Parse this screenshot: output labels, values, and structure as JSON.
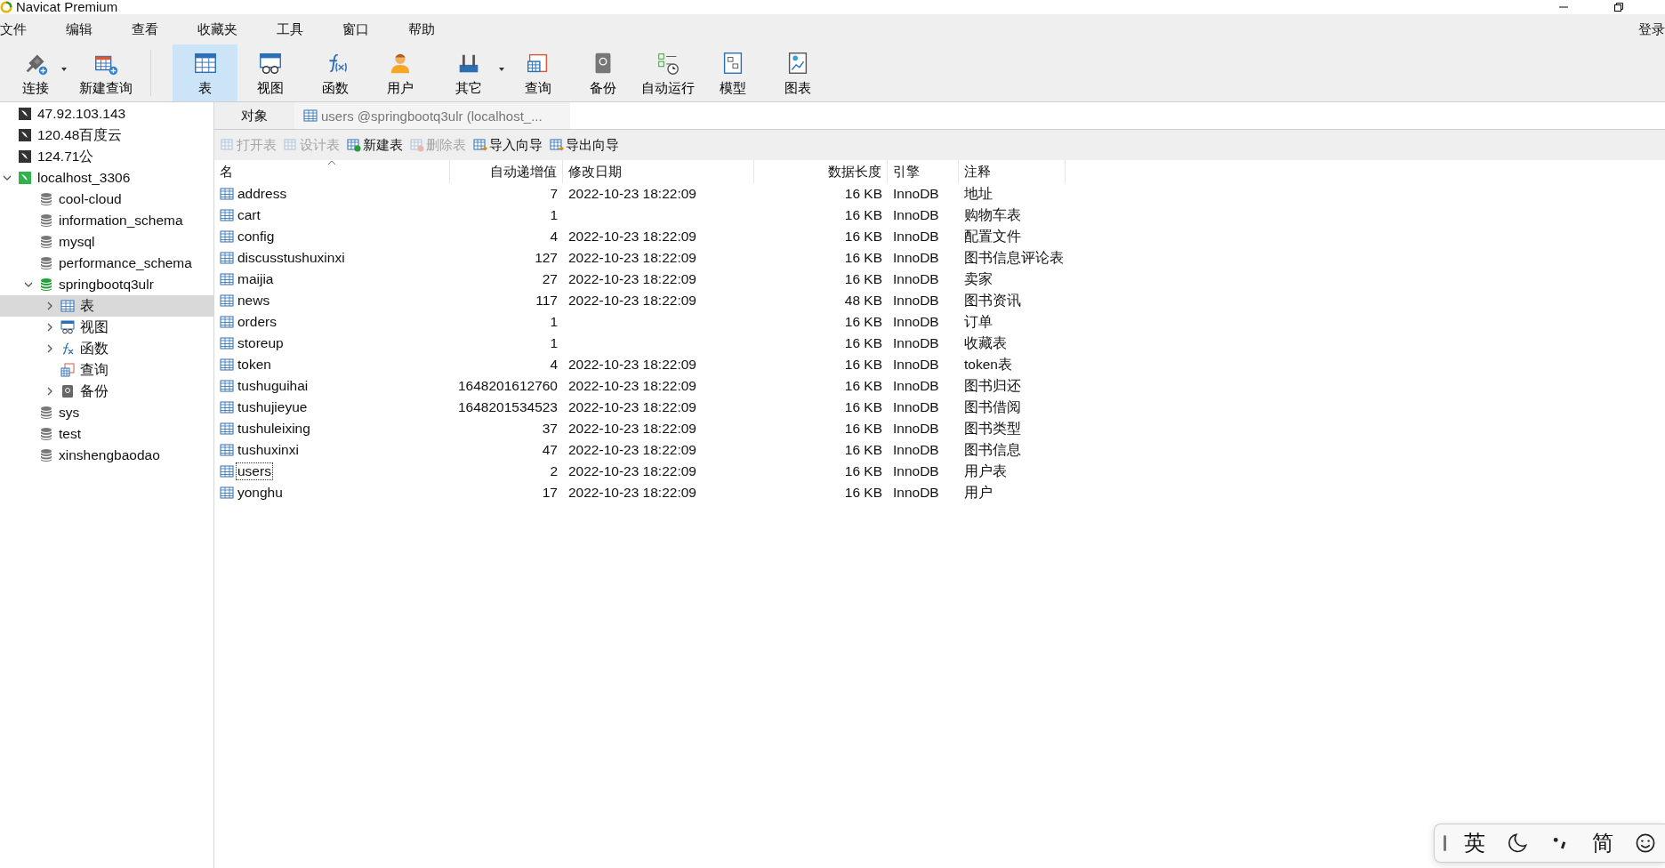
{
  "window": {
    "title": "Navicat Premium"
  },
  "menu": [
    "文件",
    "编辑",
    "查看",
    "收藏夹",
    "工具",
    "窗口",
    "帮助"
  ],
  "login": "登录",
  "toolbar": [
    {
      "label": "连接",
      "kind": "connect",
      "selected": false,
      "has_menu": true
    },
    {
      "label": "新建查询",
      "kind": "newquery",
      "selected": false,
      "has_menu": false
    },
    {
      "label": "表",
      "kind": "table",
      "selected": true,
      "has_menu": false
    },
    {
      "label": "视图",
      "kind": "view",
      "selected": false,
      "has_menu": false
    },
    {
      "label": "函数",
      "kind": "function",
      "selected": false,
      "has_menu": false
    },
    {
      "label": "用户",
      "kind": "user",
      "selected": false,
      "has_menu": false
    },
    {
      "label": "其它",
      "kind": "tools",
      "selected": false,
      "has_menu": true
    },
    {
      "label": "查询",
      "kind": "query",
      "selected": false,
      "has_menu": false
    },
    {
      "label": "备份",
      "kind": "backup",
      "selected": false,
      "has_menu": false
    },
    {
      "label": "自动运行",
      "kind": "schedule",
      "selected": false,
      "has_menu": false
    },
    {
      "label": "模型",
      "kind": "model",
      "selected": false,
      "has_menu": false
    },
    {
      "label": "图表",
      "kind": "chart",
      "selected": false,
      "has_menu": false
    }
  ],
  "sidebar": {
    "items": [
      {
        "label": "47.92.103.143",
        "kind": "connection",
        "active": false
      },
      {
        "label": "120.48百度云",
        "kind": "connection",
        "active": false
      },
      {
        "label": "124.71公",
        "kind": "connection",
        "active": false
      },
      {
        "label": "localhost_3306",
        "kind": "connection",
        "active": true,
        "expanded": true,
        "children": [
          {
            "label": "cool-cloud",
            "kind": "database",
            "active": false
          },
          {
            "label": "information_schema",
            "kind": "database",
            "active": false
          },
          {
            "label": "mysql",
            "kind": "database",
            "active": false
          },
          {
            "label": "performance_schema",
            "kind": "database",
            "active": false
          },
          {
            "label": "springbootq3ulr",
            "kind": "database",
            "active": true,
            "expanded": true,
            "children": [
              {
                "label": "表",
                "kind": "table",
                "selected": true,
                "expanded": false
              },
              {
                "label": "视图",
                "kind": "view",
                "selected": false,
                "expanded": false
              },
              {
                "label": "函数",
                "kind": "function",
                "selected": false,
                "expanded": false
              },
              {
                "label": "查询",
                "kind": "query",
                "selected": false
              },
              {
                "label": "备份",
                "kind": "backup",
                "selected": false,
                "expanded": false
              }
            ]
          },
          {
            "label": "sys",
            "kind": "database",
            "active": false
          },
          {
            "label": "test",
            "kind": "database",
            "active": false
          },
          {
            "label": "xinshengbaodao",
            "kind": "database",
            "active": false
          }
        ]
      }
    ]
  },
  "tabs": [
    {
      "label": "对象",
      "kind": "objects",
      "selected": true
    },
    {
      "label": "users @springbootq3ulr (localhost_...",
      "kind": "table",
      "selected": false
    }
  ],
  "actions": [
    {
      "label": "打开表",
      "kind": "open",
      "disabled": true
    },
    {
      "label": "设计表",
      "kind": "design",
      "disabled": true
    },
    {
      "label": "新建表",
      "kind": "new",
      "disabled": false
    },
    {
      "label": "删除表",
      "kind": "delete",
      "disabled": true
    },
    {
      "label": "导入向导",
      "kind": "import",
      "disabled": false
    },
    {
      "label": "导出向导",
      "kind": "export",
      "disabled": false
    }
  ],
  "table": {
    "columns": [
      {
        "label": "名",
        "sorted": true
      },
      {
        "label": "自动递增值",
        "sorted": false
      },
      {
        "label": "修改日期",
        "sorted": false
      },
      {
        "label": "数据长度",
        "sorted": false
      },
      {
        "label": "引擎",
        "sorted": false
      },
      {
        "label": "注释",
        "sorted": false
      }
    ],
    "rows": [
      {
        "name": "address",
        "auto_increment": "7",
        "modified": "2022-10-23 18:22:09",
        "data_length": "16 KB",
        "engine": "InnoDB",
        "comment": "地址",
        "focused": false
      },
      {
        "name": "cart",
        "auto_increment": "1",
        "data_length": "16 KB",
        "engine": "InnoDB",
        "comment": "购物车表",
        "focused": false
      },
      {
        "name": "config",
        "auto_increment": "4",
        "modified": "2022-10-23 18:22:09",
        "data_length": "16 KB",
        "engine": "InnoDB",
        "comment": "配置文件",
        "focused": false
      },
      {
        "name": "discusstushuxinxi",
        "auto_increment": "127",
        "modified": "2022-10-23 18:22:09",
        "data_length": "16 KB",
        "engine": "InnoDB",
        "comment": "图书信息评论表",
        "focused": false
      },
      {
        "name": "maijia",
        "auto_increment": "27",
        "modified": "2022-10-23 18:22:09",
        "data_length": "16 KB",
        "engine": "InnoDB",
        "comment": "卖家",
        "focused": false
      },
      {
        "name": "news",
        "auto_increment": "117",
        "modified": "2022-10-23 18:22:09",
        "data_length": "48 KB",
        "engine": "InnoDB",
        "comment": "图书资讯",
        "focused": false
      },
      {
        "name": "orders",
        "auto_increment": "1",
        "data_length": "16 KB",
        "engine": "InnoDB",
        "comment": "订单",
        "focused": false
      },
      {
        "name": "storeup",
        "auto_increment": "1",
        "data_length": "16 KB",
        "engine": "InnoDB",
        "comment": "收藏表",
        "focused": false
      },
      {
        "name": "token",
        "auto_increment": "4",
        "modified": "2022-10-23 18:22:09",
        "data_length": "16 KB",
        "engine": "InnoDB",
        "comment": "token表",
        "focused": false
      },
      {
        "name": "tushuguihai",
        "auto_increment": "1648201612760",
        "modified": "2022-10-23 18:22:09",
        "data_length": "16 KB",
        "engine": "InnoDB",
        "comment": "图书归还",
        "focused": false
      },
      {
        "name": "tushujieyue",
        "auto_increment": "1648201534523",
        "modified": "2022-10-23 18:22:09",
        "data_length": "16 KB",
        "engine": "InnoDB",
        "comment": "图书借阅",
        "focused": false
      },
      {
        "name": "tushuleixing",
        "auto_increment": "37",
        "modified": "2022-10-23 18:22:09",
        "data_length": "16 KB",
        "engine": "InnoDB",
        "comment": "图书类型",
        "focused": false
      },
      {
        "name": "tushuxinxi",
        "auto_increment": "47",
        "modified": "2022-10-23 18:22:09",
        "data_length": "16 KB",
        "engine": "InnoDB",
        "comment": "图书信息",
        "focused": false
      },
      {
        "name": "users",
        "auto_increment": "2",
        "modified": "2022-10-23 18:22:09",
        "data_length": "16 KB",
        "engine": "InnoDB",
        "comment": "用户表",
        "focused": true
      },
      {
        "name": "yonghu",
        "auto_increment": "17",
        "modified": "2022-10-23 18:22:09",
        "data_length": "16 KB",
        "engine": "InnoDB",
        "comment": "用户",
        "focused": false
      }
    ]
  },
  "ime_bar": {
    "language": "英",
    "script": "简"
  }
}
